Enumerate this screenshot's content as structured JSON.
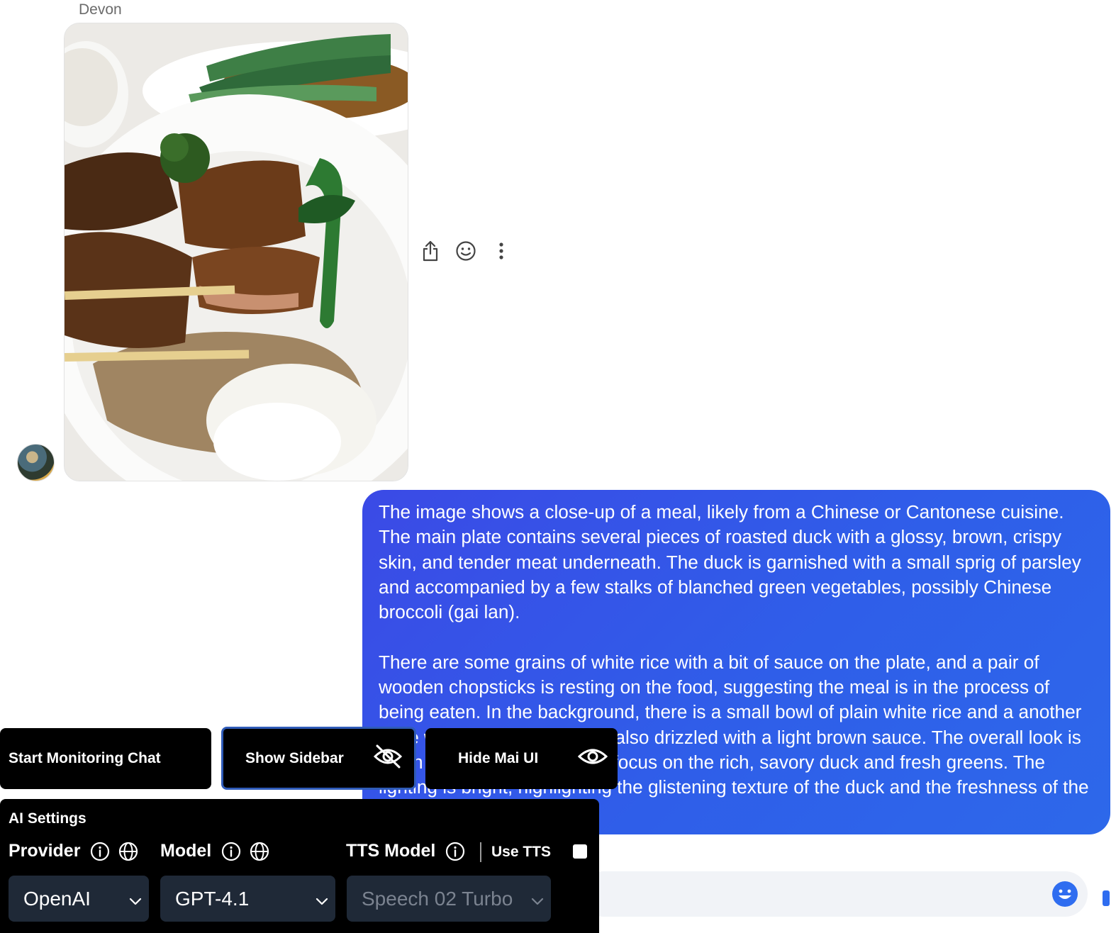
{
  "message": {
    "sender": "Devon",
    "photo_alt": "Photo of a meal",
    "actions": [
      "share-icon",
      "emoji-react-icon",
      "more-options-icon"
    ]
  },
  "reply": {
    "paragraphs": [
      "The image shows a close-up of a meal, likely from a Chinese or Cantonese cuisine. The main plate contains several pieces of roasted duck with a glossy, brown, crispy skin, and tender meat underneath. The duck is garnished with a small sprig of parsley and accompanied by a few stalks of blanched green vegetables, possibly Chinese broccoli (gai lan).",
      "There are some grains of white rice with a bit of sauce on the plate, and a pair of wooden chopsticks is resting on the food, suggesting the meal is in the process of being eaten. In the background, there is a small bowl of plain white rice and a another plate with green vegetables, also drizzled with a light brown sauce. The overall look is clean and appetizing, with a focus on the rich, savory duck and fresh greens. The lighting is bright, highlighting the glistening texture of the duck and the freshness of the vegetables."
    ],
    "colors": {
      "start": "#3b4ae6",
      "end": "#2d68ea"
    }
  },
  "toolbar": {
    "monitor_label": "Start Monitoring Chat",
    "sidebar_label": "Show Sidebar",
    "hide_label": "Hide Mai UI"
  },
  "settings": {
    "title": "AI Settings",
    "provider_label": "Provider",
    "model_label": "Model",
    "tts_model_label": "TTS Model",
    "use_tts_label": "Use TTS",
    "use_tts_checked": false,
    "provider_value": "OpenAI",
    "model_value": "GPT-4.1",
    "tts_value": "Speech 02 Turbo"
  }
}
